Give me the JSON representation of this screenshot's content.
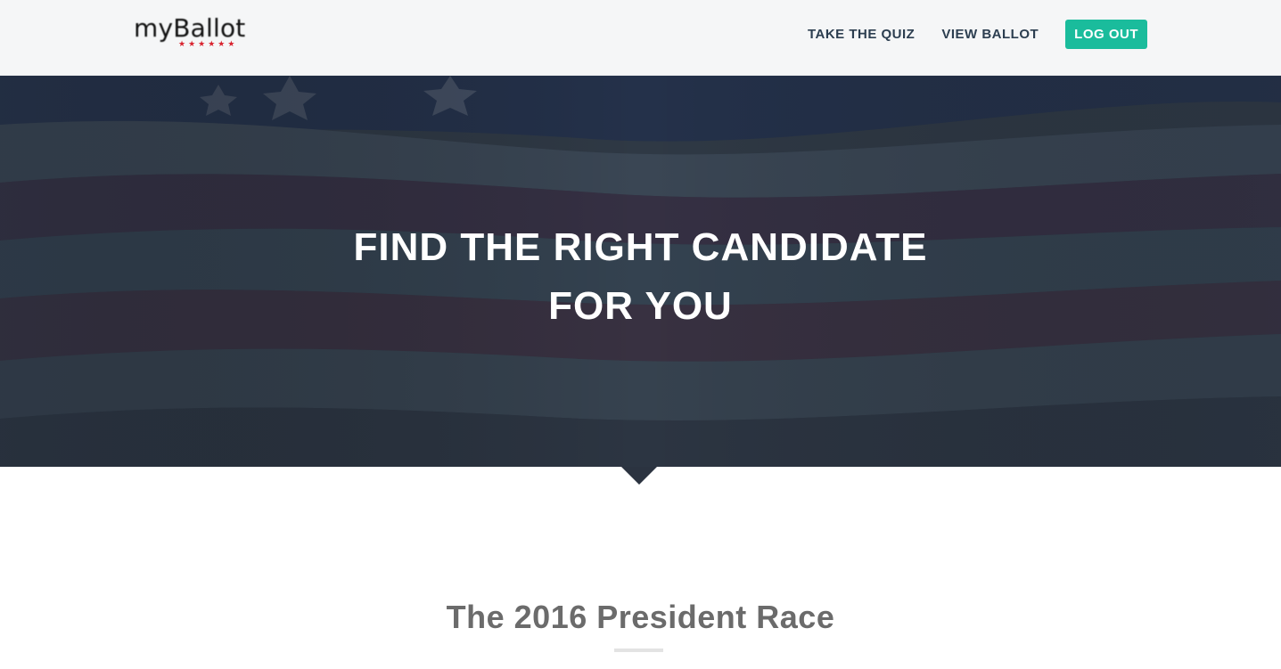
{
  "brand": {
    "name": "myBallot",
    "stars": "★★★★★★"
  },
  "nav": {
    "items": [
      {
        "label": "TAKE THE QUIZ"
      },
      {
        "label": "VIEW BALLOT"
      }
    ],
    "logout_label": "LOG OUT"
  },
  "hero": {
    "title_line1": "FIND THE RIGHT CANDIDATE",
    "title_line2": "FOR YOU"
  },
  "section": {
    "title": "The 2016 President Race"
  },
  "colors": {
    "accent": "#1abc9c",
    "nav_text": "#2c3e50",
    "hero_overlay": "#2c3440",
    "section_title": "#6b6b6b"
  }
}
